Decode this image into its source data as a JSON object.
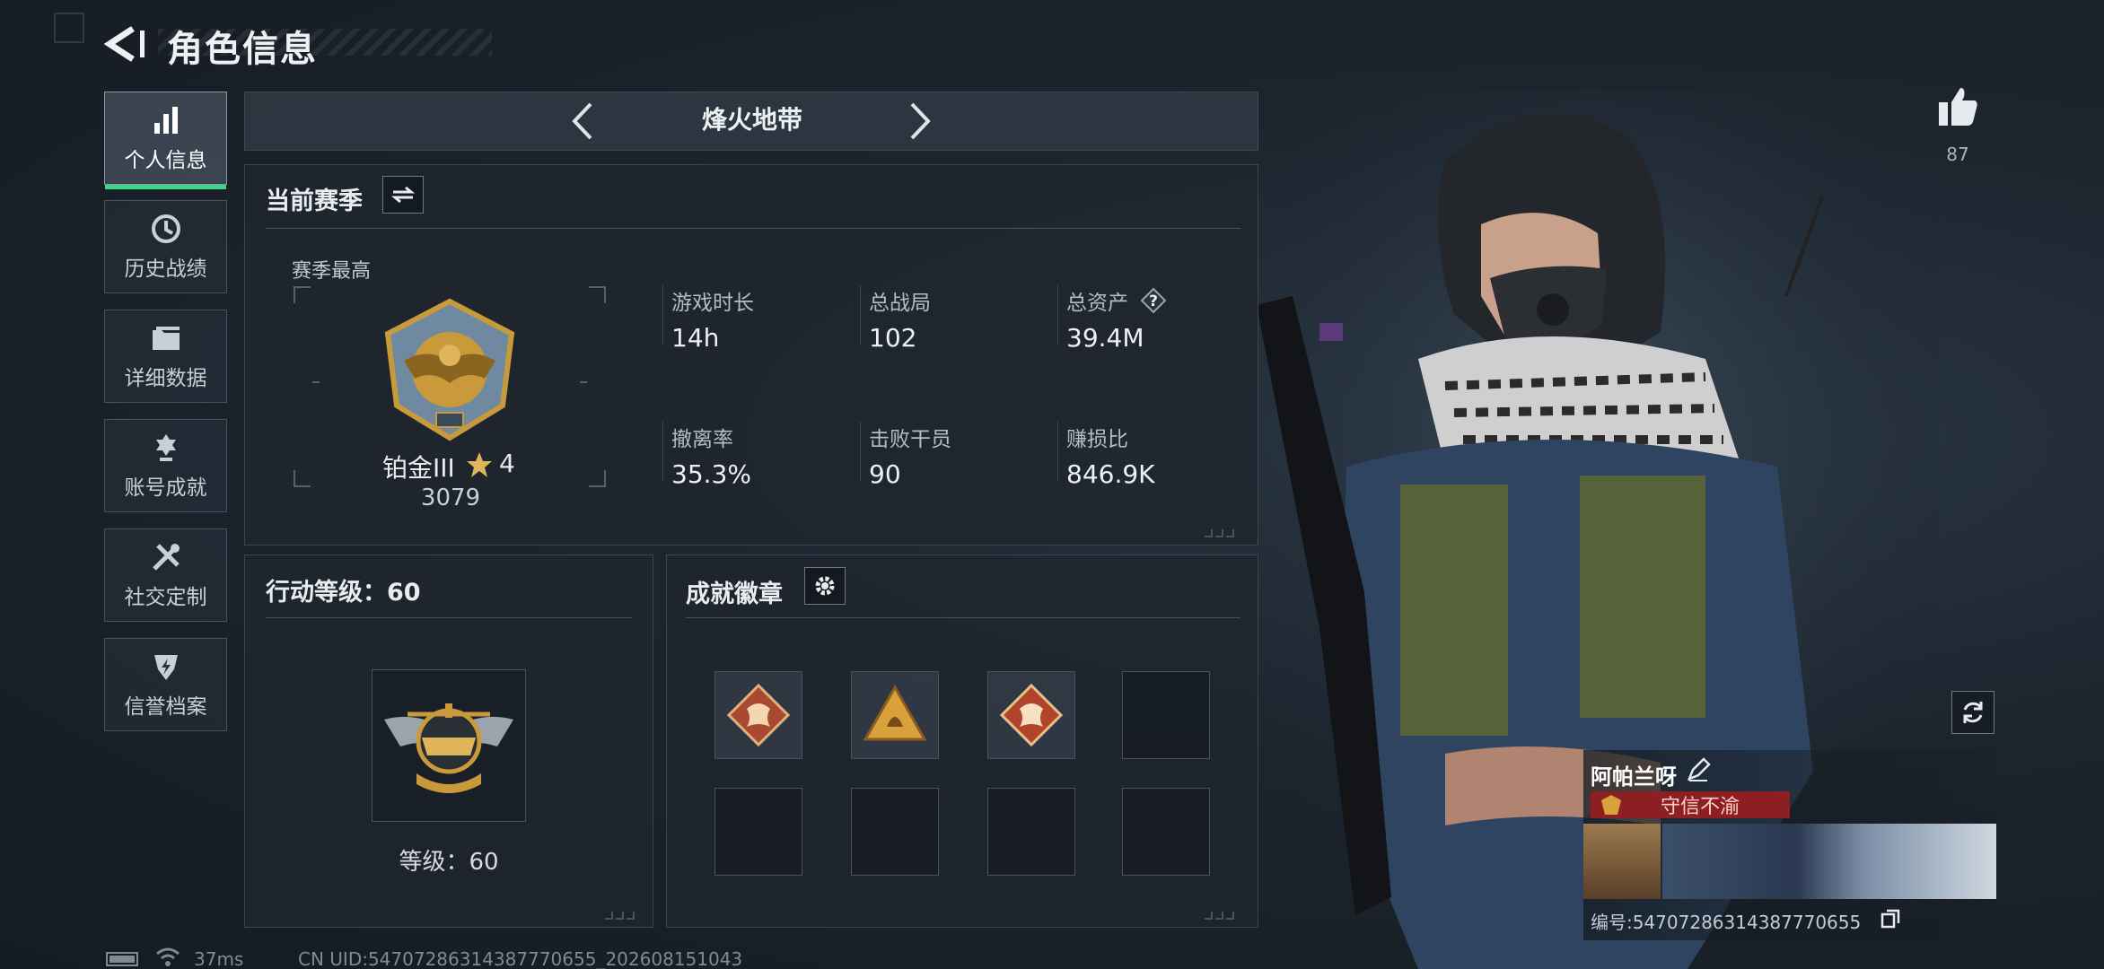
{
  "header": {
    "title": "角色信息"
  },
  "sidebar": {
    "items": [
      {
        "label": "个人信息",
        "icon": "bar-chart-icon",
        "active": true
      },
      {
        "label": "历史战绩",
        "icon": "history-clock-icon"
      },
      {
        "label": "详细数据",
        "icon": "folder-icon"
      },
      {
        "label": "账号成就",
        "icon": "medal-icon"
      },
      {
        "label": "社交定制",
        "icon": "tools-icon"
      },
      {
        "label": "信誉档案",
        "icon": "shield-bolt-icon"
      }
    ]
  },
  "mode_selector": {
    "current": "烽火地带"
  },
  "season": {
    "title": "当前赛季",
    "best_label": "赛季最高",
    "rank_name": "铂金III",
    "rank_stars": "4",
    "rank_score": "3079",
    "stats": [
      {
        "label": "游戏时长",
        "value": "14h"
      },
      {
        "label": "总战局",
        "value": "102"
      },
      {
        "label": "总资产",
        "value": "39.4M",
        "has_help": true
      },
      {
        "label": "撤离率",
        "value": "35.3%"
      },
      {
        "label": "击败干员",
        "value": "90"
      },
      {
        "label": "赚损比",
        "value": "846.9K"
      }
    ]
  },
  "action_level": {
    "title": "行动等级：60",
    "level_text": "等级：60"
  },
  "achievements": {
    "title": "成就徽章",
    "badges": [
      "dragon-badge-icon",
      "triangle-beast-badge-icon",
      "dragon-badge-icon",
      "",
      "",
      "",
      "",
      ""
    ]
  },
  "profile": {
    "likes": "87",
    "player_name": "阿帕兰呀",
    "title_tag": "守信不渝",
    "player_id": "编号:547072863143877706​55"
  },
  "footer": {
    "ping": "37ms",
    "uid": "CN UID:547072863143877706​55_202608151043"
  },
  "colors": {
    "accent": "#3bd68a",
    "title_tag_bg": "#8c1f22"
  }
}
